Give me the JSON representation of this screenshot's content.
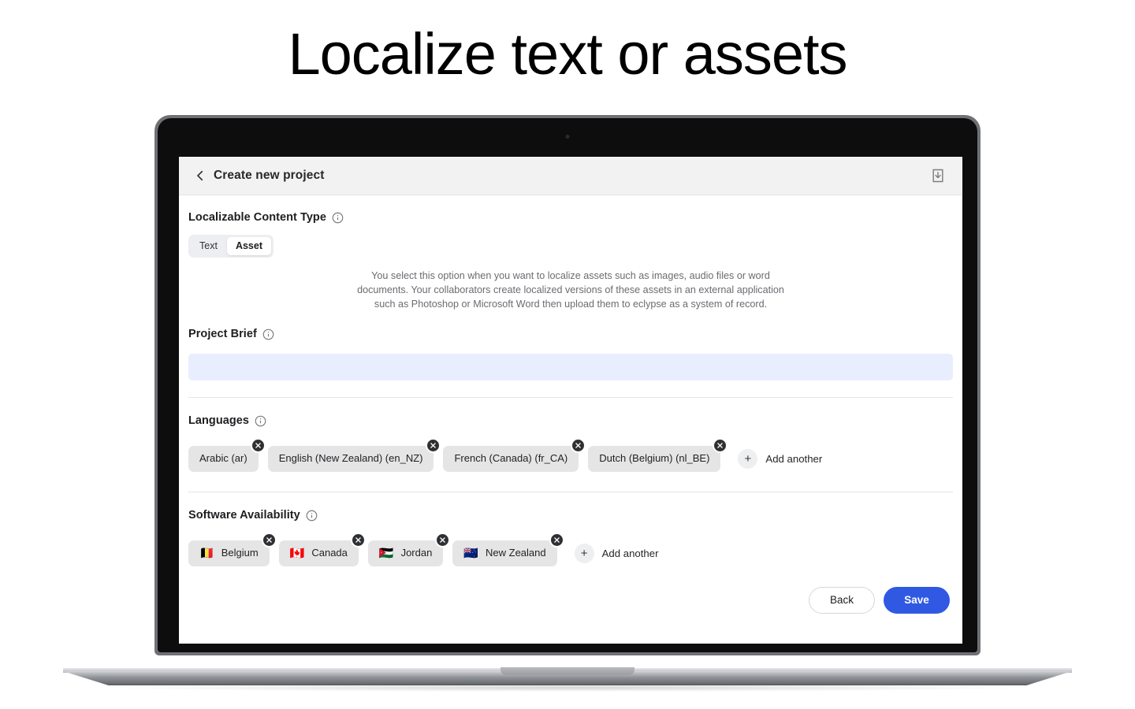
{
  "page": {
    "title": "Localize text or assets"
  },
  "device": {
    "label": "MacBook Air"
  },
  "app": {
    "header": {
      "back_icon": "chevron-left-icon",
      "title": "Create new project",
      "import_icon": "import-icon"
    },
    "content_type": {
      "label": "Localizable Content Type",
      "info_icon": "info-icon",
      "options": [
        {
          "label": "Text",
          "selected": false
        },
        {
          "label": "Asset",
          "selected": true
        }
      ],
      "helper_text": "You select this option when you want to localize assets such as images, audio files or word documents. Your collaborators create localized versions of these assets in an external application such as Photoshop or Microsoft Word then upload them to eclypse as a system of record."
    },
    "project_brief": {
      "label": "Project Brief",
      "info_icon": "info-icon",
      "value": "",
      "placeholder": ""
    },
    "languages": {
      "label": "Languages",
      "info_icon": "info-icon",
      "chips": [
        {
          "label": "Arabic (ar)",
          "remove_icon": "close-icon"
        },
        {
          "label": "English (New Zealand) (en_NZ)",
          "remove_icon": "close-icon"
        },
        {
          "label": "French (Canada) (fr_CA)",
          "remove_icon": "close-icon"
        },
        {
          "label": "Dutch (Belgium) (nl_BE)",
          "remove_icon": "close-icon"
        }
      ],
      "add_another": {
        "icon": "plus-icon",
        "label": "Add another"
      }
    },
    "software_availability": {
      "label": "Software Availability",
      "info_icon": "info-icon",
      "chips": [
        {
          "flag": "🇧🇪",
          "label": "Belgium",
          "remove_icon": "close-icon"
        },
        {
          "flag": "🇨🇦",
          "label": "Canada",
          "remove_icon": "close-icon"
        },
        {
          "flag": "🇯🇴",
          "label": "Jordan",
          "remove_icon": "close-icon"
        },
        {
          "flag": "🇳🇿",
          "label": "New Zealand",
          "remove_icon": "close-icon"
        }
      ],
      "add_another": {
        "icon": "plus-icon",
        "label": "Add another"
      }
    },
    "footer": {
      "back_label": "Back",
      "save_label": "Save"
    }
  },
  "colors": {
    "primary": "#3059e3",
    "input_bg": "#e9eeff",
    "chip_bg": "#e5e5e6",
    "chip_remove": "#2f3033"
  }
}
